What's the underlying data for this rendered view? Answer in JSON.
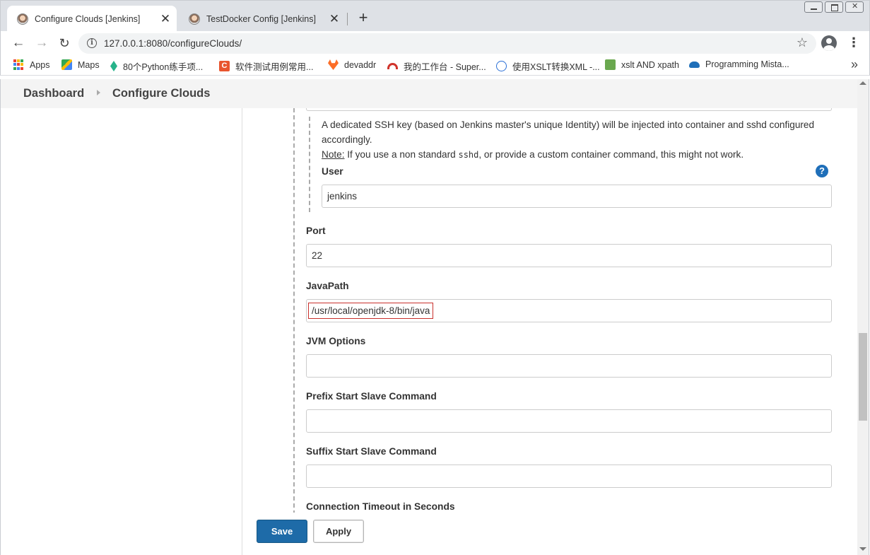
{
  "browser": {
    "tabs": [
      {
        "title": "Configure Clouds [Jenkins]",
        "active": true
      },
      {
        "title": "TestDocker Config [Jenkins]",
        "active": false
      }
    ],
    "new_tab_glyph": "+",
    "close_glyph": "✕",
    "url": "127.0.0.1:8080/configureClouds/",
    "bookmarks": [
      {
        "label": "Apps",
        "icon": "apps-grid-icon"
      },
      {
        "label": "Maps",
        "icon": "maps-icon"
      },
      {
        "label": "80个Python练手项...",
        "icon": "leaf-icon"
      },
      {
        "label": "软件测试用例常用...",
        "icon": "c-logo-icon"
      },
      {
        "label": "devaddr",
        "icon": "gitlab-icon"
      },
      {
        "label": "我的工作台 - Super...",
        "icon": "rainbow-icon"
      },
      {
        "label": "使用XSLT转换XML -...",
        "icon": "translate-icon"
      },
      {
        "label": "xslt AND xpath",
        "icon": "green-logo-icon"
      },
      {
        "label": "Programming Mista...",
        "icon": "cloud-icon"
      }
    ],
    "bookmarks_more": "»"
  },
  "breadcrumb": {
    "items": [
      "Dashboard",
      "Configure Clouds"
    ]
  },
  "form": {
    "ssh_help": {
      "line1": "A dedicated SSH key (based on Jenkins master's unique Identity) will be injected into container and sshd configured accordingly.",
      "note_label": "Note:",
      "note_pre": " If you use a non standard ",
      "note_code": "sshd",
      "note_post": ", or provide a custom container command, this might not work."
    },
    "user": {
      "label": "User",
      "value": "jenkins"
    },
    "help_glyph": "?",
    "port": {
      "label": "Port",
      "value": "22"
    },
    "java_path": {
      "label": "JavaPath",
      "value": "/usr/local/openjdk-8/bin/java"
    },
    "jvm_options": {
      "label": "JVM Options",
      "value": ""
    },
    "prefix_start": {
      "label": "Prefix Start Slave Command",
      "value": ""
    },
    "suffix_start": {
      "label": "Suffix Start Slave Command",
      "value": ""
    },
    "connection_timeout": {
      "label": "Connection Timeout in Seconds"
    }
  },
  "buttons": {
    "save": "Save",
    "apply": "Apply"
  },
  "colors": {
    "save_button": "#1e6ba8",
    "help_icon": "#1f6fb9",
    "highlight_border": "#c9302c"
  }
}
